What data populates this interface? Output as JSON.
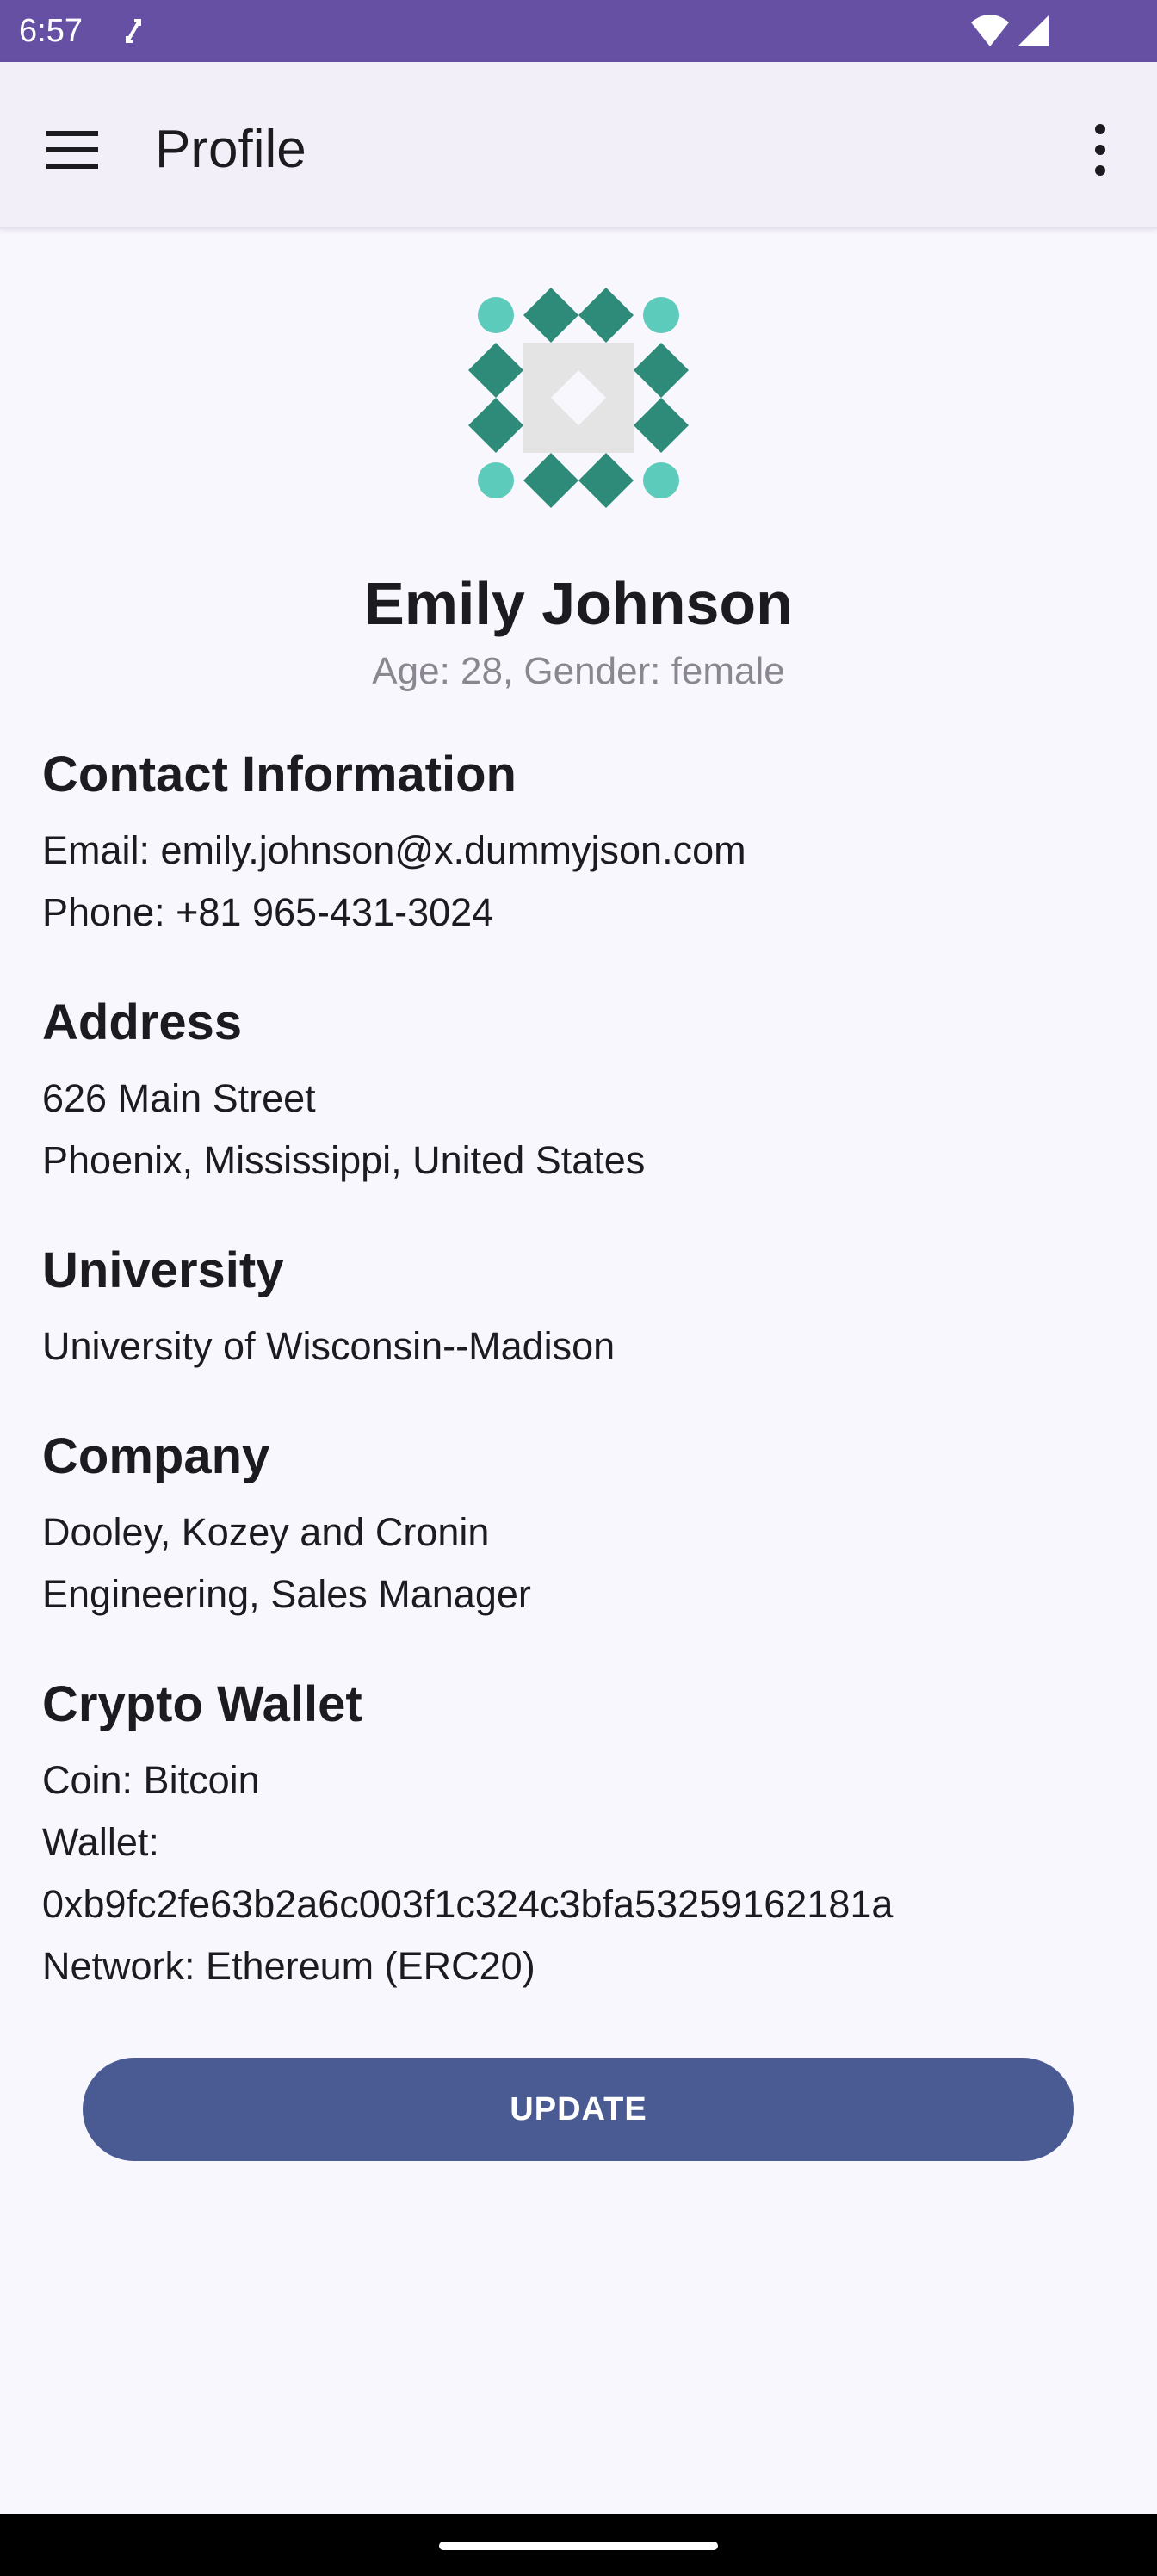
{
  "status_bar": {
    "time": "6:57",
    "sync_icon": "sync-icon",
    "wifi_icon": "wifi-icon",
    "signal_icon": "cell-signal-icon",
    "background": "#6650a4"
  },
  "app_bar": {
    "title": "Profile",
    "menu_icon": "hamburger-menu-icon",
    "more_icon": "more-vert-icon",
    "background": "#f2eff8"
  },
  "profile": {
    "avatar_icon": "identicon-avatar",
    "name": "Emily Johnson",
    "meta": "Age: 28, Gender: female"
  },
  "sections": {
    "contact": {
      "title": "Contact Information",
      "lines": [
        "Email: emily.johnson@x.dummyjson.com",
        "Phone: +81 965-431-3024"
      ]
    },
    "address": {
      "title": "Address",
      "lines": [
        "626 Main Street",
        "Phoenix, Mississippi, United States"
      ]
    },
    "university": {
      "title": "University",
      "lines": [
        "University of Wisconsin--Madison"
      ]
    },
    "company": {
      "title": "Company",
      "lines": [
        "Dooley, Kozey and Cronin",
        "Engineering, Sales Manager"
      ]
    },
    "crypto": {
      "title": "Crypto Wallet",
      "lines": [
        "Coin: Bitcoin",
        "Wallet:",
        "0xb9fc2fe63b2a6c003f1c324c3bfa53259162181a",
        "Network: Ethereum (ERC20)"
      ]
    }
  },
  "actions": {
    "update_label": "UPDATE",
    "button_color": "#4a5a92"
  },
  "colors": {
    "avatar_teal": "#2e8b7a",
    "avatar_light_teal": "#5ccbbb",
    "avatar_grey": "#e4e4e4"
  }
}
